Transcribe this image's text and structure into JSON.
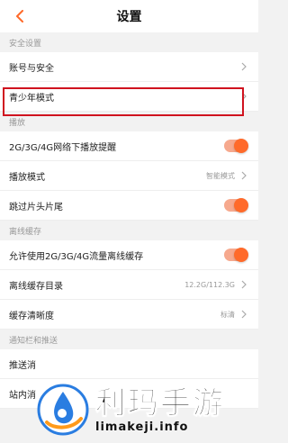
{
  "header": {
    "title": "设置"
  },
  "sections": [
    {
      "label": "安全设置",
      "rows": [
        {
          "label": "账号与安全",
          "control": "chevron"
        },
        {
          "label": "青少年模式",
          "control": "chevron"
        }
      ]
    },
    {
      "label": "播放",
      "rows": [
        {
          "label": "2G/3G/4G网络下播放提醒",
          "control": "toggle",
          "on": true
        },
        {
          "label": "播放模式",
          "value": "智能模式",
          "control": "chevron"
        },
        {
          "label": "跳过片头片尾",
          "control": "toggle",
          "on": true
        }
      ]
    },
    {
      "label": "离线缓存",
      "rows": [
        {
          "label": "允许使用2G/3G/4G流量离线缓存",
          "control": "toggle",
          "on": true
        },
        {
          "label": "离线缓存目录",
          "value": "12.2G/112.3G",
          "control": "chevron"
        },
        {
          "label": "缓存清晰度",
          "value": "标清",
          "control": "chevron"
        }
      ]
    },
    {
      "label": "通知栏和推送",
      "rows": [
        {
          "label": "推送消",
          "control": "none"
        },
        {
          "label": "站内消",
          "control": "none"
        }
      ]
    }
  ],
  "watermark": {
    "title": "利玛手游",
    "url": "limakeji.info"
  },
  "colors": {
    "accent": "#ff6a2a",
    "highlight": "#d0131f"
  }
}
